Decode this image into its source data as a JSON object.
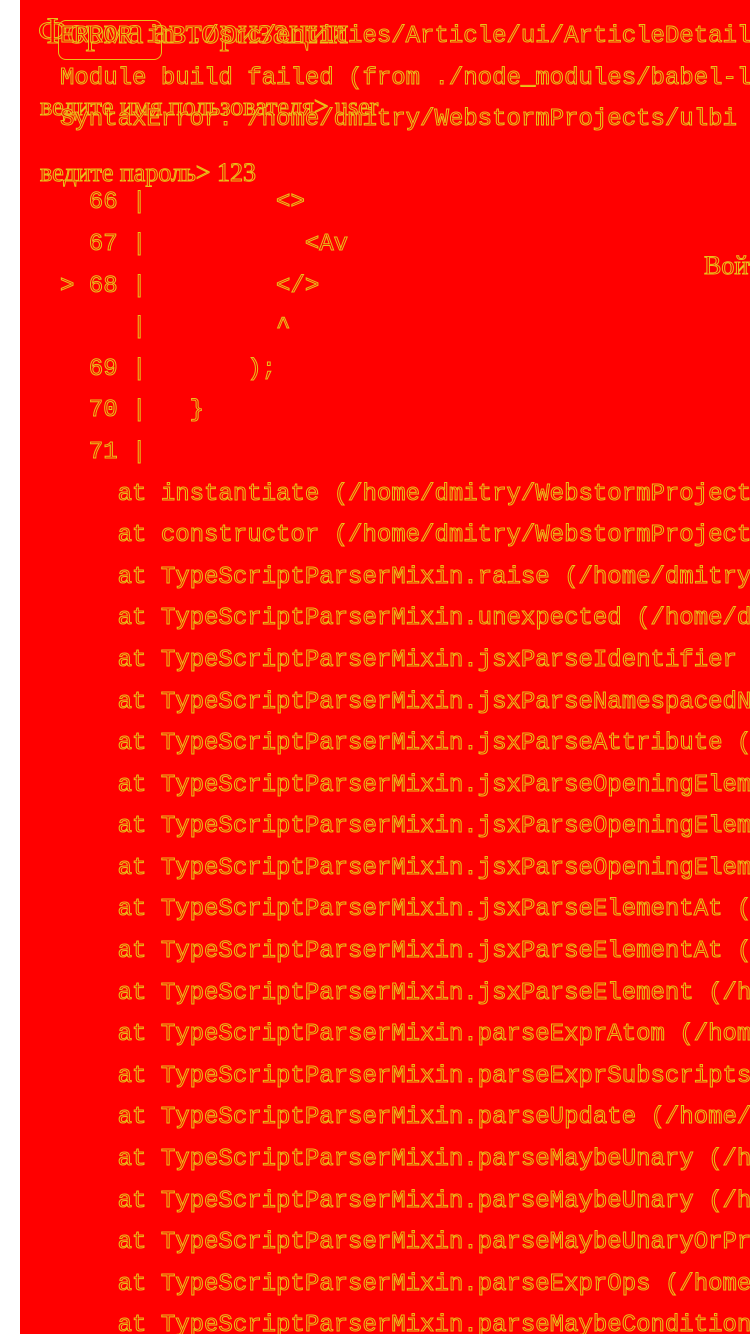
{
  "form": {
    "title": "Форма авторизации",
    "username_label": "ведите имя пользователя>",
    "username_value": "user",
    "password_label": "ведите пароль>",
    "password_value": "123",
    "login_button": "Войти"
  },
  "error_overlay": {
    "lines": [
      "ERROR in ./src/entities/Article/ui/ArticleDetails",
      "Module build failed (from ./node_modules/babel-loader",
      "SyntaxError: /home/dmitry/WebstormProjects/ulbi",
      "",
      "  66 |         <>",
      "  67 |           <Av",
      "> 68 |         </>",
      "     |         ^",
      "  69 |       );",
      "  70 |   }",
      "  71 |",
      "    at instantiate (/home/dmitry/WebstormProjects/",
      "    at constructor (/home/dmitry/WebstormProjects/",
      "    at TypeScriptParserMixin.raise (/home/dmitry/",
      "    at TypeScriptParserMixin.unexpected (/home/dm",
      "    at TypeScriptParserMixin.jsxParseIdentifier (",
      "    at TypeScriptParserMixin.jsxParseNamespacedNam",
      "    at TypeScriptParserMixin.jsxParseAttribute (/h",
      "    at TypeScriptParserMixin.jsxParseOpeningElement",
      "    at TypeScriptParserMixin.jsxParseOpeningElement",
      "    at TypeScriptParserMixin.jsxParseOpeningElement",
      "    at TypeScriptParserMixin.jsxParseElementAt (/h",
      "    at TypeScriptParserMixin.jsxParseElementAt (/h",
      "    at TypeScriptParserMixin.jsxParseElement (/hom",
      "    at TypeScriptParserMixin.parseExprAtom (/home/",
      "    at TypeScriptParserMixin.parseExprSubscripts (",
      "    at TypeScriptParserMixin.parseUpdate (/home/dm",
      "    at TypeScriptParserMixin.parseMaybeUnary (/hom",
      "    at TypeScriptParserMixin.parseMaybeUnary (/hom",
      "    at TypeScriptParserMixin.parseMaybeUnaryOrPriv",
      "    at TypeScriptParserMixin.parseExprOps (/home/d",
      "    at TypeScriptParserMixin.parseMaybeConditional"
    ]
  },
  "colors": {
    "overlay_background": "#ff0000",
    "text_outline": "#e8c21a",
    "page_background": "#ffffff"
  }
}
